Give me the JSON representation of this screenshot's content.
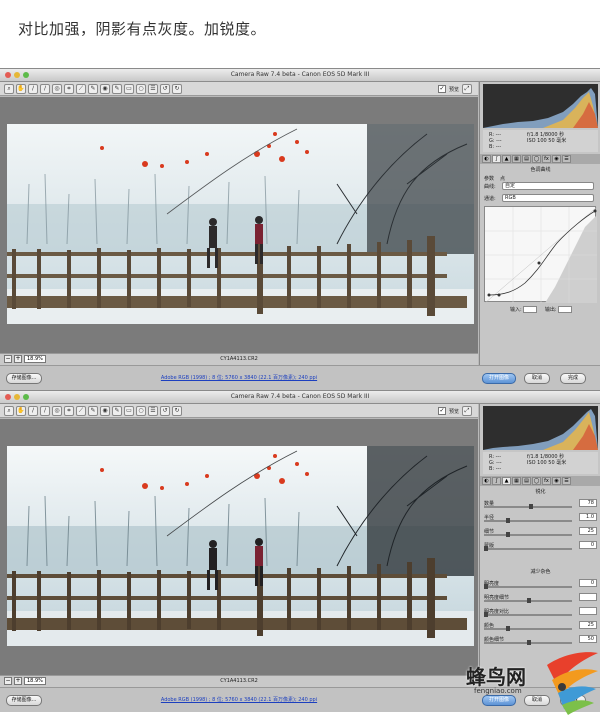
{
  "caption": "对比加强，阴影有点灰度。加锐度。",
  "window_title": "Camera Raw 7.4 beta -  Canon EOS 5D Mark III",
  "toolbar": {
    "tools": [
      "zoom",
      "hand",
      "white-balance",
      "color-sampler",
      "target",
      "crop",
      "straighten",
      "spot",
      "red-eye",
      "adjust-brush",
      "grad-filter",
      "radial",
      "prefs",
      "rotate-left",
      "rotate-right"
    ],
    "preview_label": "预览"
  },
  "status": {
    "zoom_value": "18.9%",
    "filename": "CY1A4113.CR2"
  },
  "bottombar": {
    "save_label": "存储图像...",
    "workflow_link": "Adobe RGB (1998) ; 8 位; 5760 x 3840 (22.1 百万像素); 240 ppi",
    "open_label": "打开图像",
    "cancel_label": "取消",
    "done_label": "完成"
  },
  "panel1": {
    "readout_left": [
      "R:  ---",
      "G:  ---",
      "B:  ---"
    ],
    "readout_right": [
      "f/1.8   1/8000 秒",
      "ISO 100   50 毫米"
    ],
    "section": "色调曲线",
    "tab_param": "参数",
    "tab_point": "点",
    "curve_label": "曲线:",
    "curve_value": "自定",
    "channel_label": "通道:",
    "channel_value": "RGB",
    "input_label": "输入:",
    "output_label": "输出:"
  },
  "panel2": {
    "readout_left": [
      "R:  ---",
      "G:  ---",
      "B:  ---"
    ],
    "readout_right": [
      "f/1.8   1/8000 秒",
      "ISO 100   50 毫米"
    ],
    "sharpen_title": "锐化",
    "sharpen": [
      {
        "label": "数量",
        "value": "78",
        "frac": 0.52
      },
      {
        "label": "半径",
        "value": "1.0",
        "frac": 0.25
      },
      {
        "label": "细节",
        "value": "25",
        "frac": 0.25
      },
      {
        "label": "蒙版",
        "value": "0",
        "frac": 0.0
      }
    ],
    "nr_title": "减少杂色",
    "nr": [
      {
        "label": "明亮度",
        "value": "0",
        "frac": 0.0
      },
      {
        "label": "明亮度细节",
        "value": "",
        "frac": 0.5
      },
      {
        "label": "明亮度对比",
        "value": "",
        "frac": 0.0
      },
      {
        "label": "颜色",
        "value": "25",
        "frac": 0.25
      },
      {
        "label": "颜色细节",
        "value": "50",
        "frac": 0.5
      }
    ]
  },
  "watermark": {
    "brand": "蜂鸟网",
    "url": "fengniao.com"
  }
}
